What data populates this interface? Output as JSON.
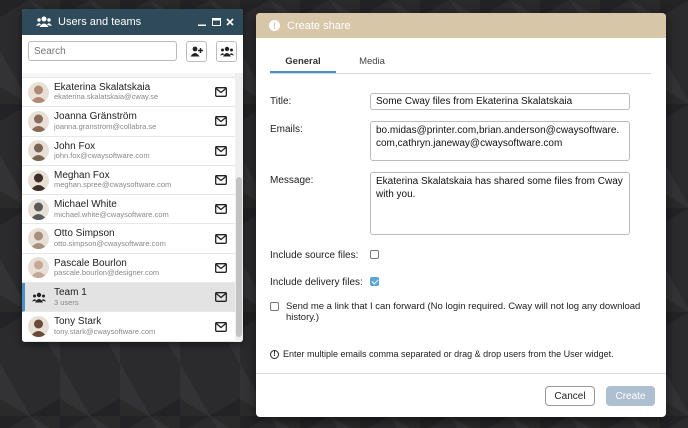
{
  "users_panel": {
    "title": "Users and teams",
    "search_placeholder": "Search",
    "users": [
      {
        "name": "Ekaterina Skalatskaia",
        "email": "ekaterina.skalatskaia@cway.se",
        "type": "person",
        "avatar_color": "#b08a76"
      },
      {
        "name": "Joanna Gränström",
        "email": "joanna.granstrom@collabra.se",
        "type": "person",
        "avatar_color": "#8a6a58"
      },
      {
        "name": "John Fox",
        "email": "john.fox@cwaysoftware.com",
        "type": "person",
        "avatar_color": "#7a6454"
      },
      {
        "name": "Meghan Fox",
        "email": "meghan.spree@cwaysoftware.com",
        "type": "person",
        "avatar_color": "#3e2e28"
      },
      {
        "name": "Michael White",
        "email": "michael.white@cwaysoftware.com",
        "type": "person",
        "avatar_color": "#5a5a5a"
      },
      {
        "name": "Otto Simpson",
        "email": "otto.simpson@cwaysoftware.com",
        "type": "person",
        "avatar_color": "#a88e7c"
      },
      {
        "name": "Pascale Bourlon",
        "email": "pascale.bourlon@designer.com",
        "type": "person",
        "avatar_color": "#c4aa96"
      },
      {
        "name": "Team 1",
        "email": "3 users",
        "type": "team",
        "avatar_color": "#ffffff"
      },
      {
        "name": "Tony Stark",
        "email": "tony.stark@cwaysoftware.com",
        "type": "person",
        "avatar_color": "#6a4a3a"
      }
    ],
    "selected_index": 7
  },
  "dialog": {
    "title": "Create share",
    "tabs": [
      "General",
      "Media"
    ],
    "active_tab": "General",
    "title_label": "Title:",
    "title_value": "Some Cway files from Ekaterina Skalatskaia",
    "emails_label": "Emails:",
    "emails_value": "bo.midas@printer.com,brian.anderson@cwaysoftware.com,cathryn.janeway@cwaysoftware.com",
    "message_label": "Message:",
    "message_value": "Ekaterina Skalatskaia has shared some files from Cway with you.",
    "include_source_label": "Include source files:",
    "include_source_checked": false,
    "include_delivery_label": "Include delivery files:",
    "include_delivery_checked": true,
    "forward_link_label": "Send me a link that I can forward (No login required. Cway will not log any download history.)",
    "forward_link_checked": false,
    "hint": "Enter multiple emails comma separated or drag & drop users from the User widget.",
    "cancel_label": "Cancel",
    "create_label": "Create"
  },
  "colors": {
    "panel_header": "#2f4a5a",
    "dialog_header": "#d8c6a8",
    "accent": "#4a90c6",
    "checkbox_checked": "#5ea4d8",
    "create_disabled": "#adbfd1"
  }
}
